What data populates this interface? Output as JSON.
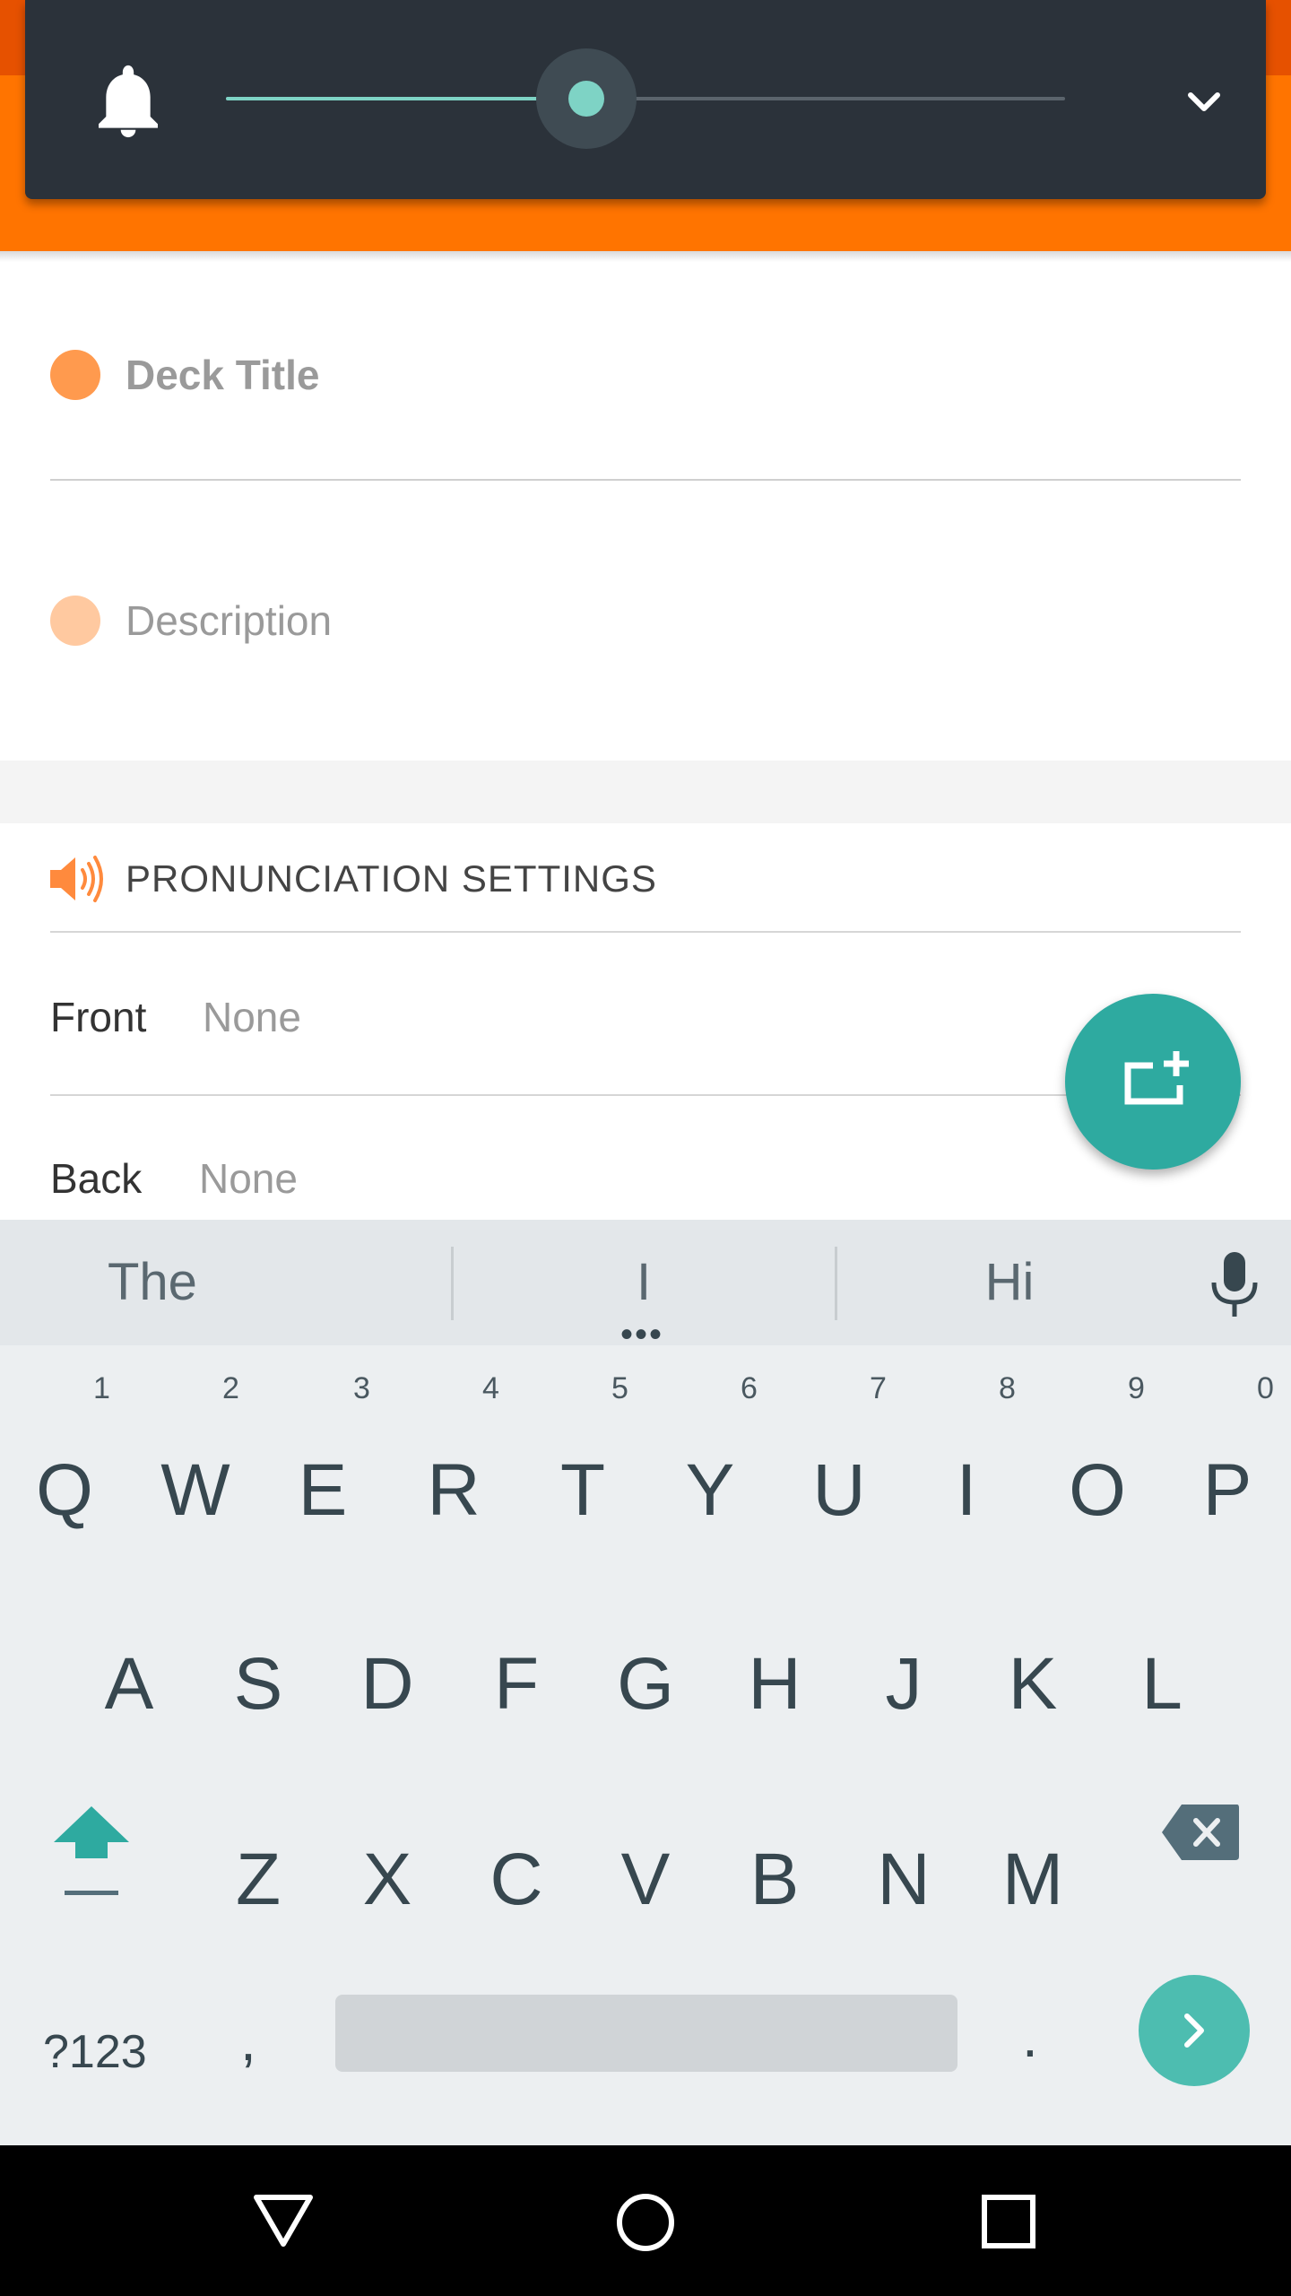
{
  "volume_overlay": {
    "level": 0.43,
    "bell_icon": "bell-icon",
    "expand_icon": "chevron-down-icon",
    "accent": "#7ed3c5"
  },
  "form": {
    "title_placeholder": "Deck Title",
    "description_placeholder": "Description"
  },
  "pronunciation": {
    "header": "PRONUNCIATION SETTINGS",
    "front_label": "Front",
    "front_value": "None",
    "back_label": "Back",
    "back_value": "None"
  },
  "fab": {
    "icon": "add-card-icon",
    "color": "#2eaaa0"
  },
  "keyboard": {
    "suggestions": [
      "The",
      "I",
      "Hi"
    ],
    "row1": [
      {
        "key": "Q",
        "hint": "1"
      },
      {
        "key": "W",
        "hint": "2"
      },
      {
        "key": "E",
        "hint": "3"
      },
      {
        "key": "R",
        "hint": "4"
      },
      {
        "key": "T",
        "hint": "5"
      },
      {
        "key": "Y",
        "hint": "6"
      },
      {
        "key": "U",
        "hint": "7"
      },
      {
        "key": "I",
        "hint": "8"
      },
      {
        "key": "O",
        "hint": "9"
      },
      {
        "key": "P",
        "hint": "0"
      }
    ],
    "row2": [
      "A",
      "S",
      "D",
      "F",
      "G",
      "H",
      "J",
      "K",
      "L"
    ],
    "row3": [
      "Z",
      "X",
      "C",
      "V",
      "B",
      "N",
      "M"
    ],
    "symbols_label": "?123",
    "comma": ",",
    "period": "."
  },
  "colors": {
    "app_bar": "#ff7400",
    "accent_teal": "#2eaaa0"
  }
}
